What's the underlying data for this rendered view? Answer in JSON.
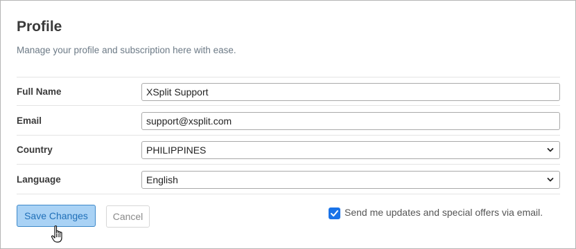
{
  "header": {
    "title": "Profile",
    "subtitle": "Manage your profile and subscription here with ease."
  },
  "form": {
    "full_name": {
      "label": "Full Name",
      "value": "XSplit Support"
    },
    "email": {
      "label": "Email",
      "value": "support@xsplit.com"
    },
    "country": {
      "label": "Country",
      "value": "PHILIPPINES"
    },
    "language": {
      "label": "Language",
      "value": "English"
    }
  },
  "actions": {
    "save_label": "Save Changes",
    "cancel_label": "Cancel"
  },
  "newsletter": {
    "label": "Send me updates and special offers via email.",
    "checked": true
  },
  "colors": {
    "accent": "#1a73e8",
    "save_bg": "#a9d2f5",
    "save_border": "#3c87c8"
  },
  "icons": [
    "chevron-down-icon",
    "checkmark-icon",
    "hand-pointer-icon"
  ]
}
